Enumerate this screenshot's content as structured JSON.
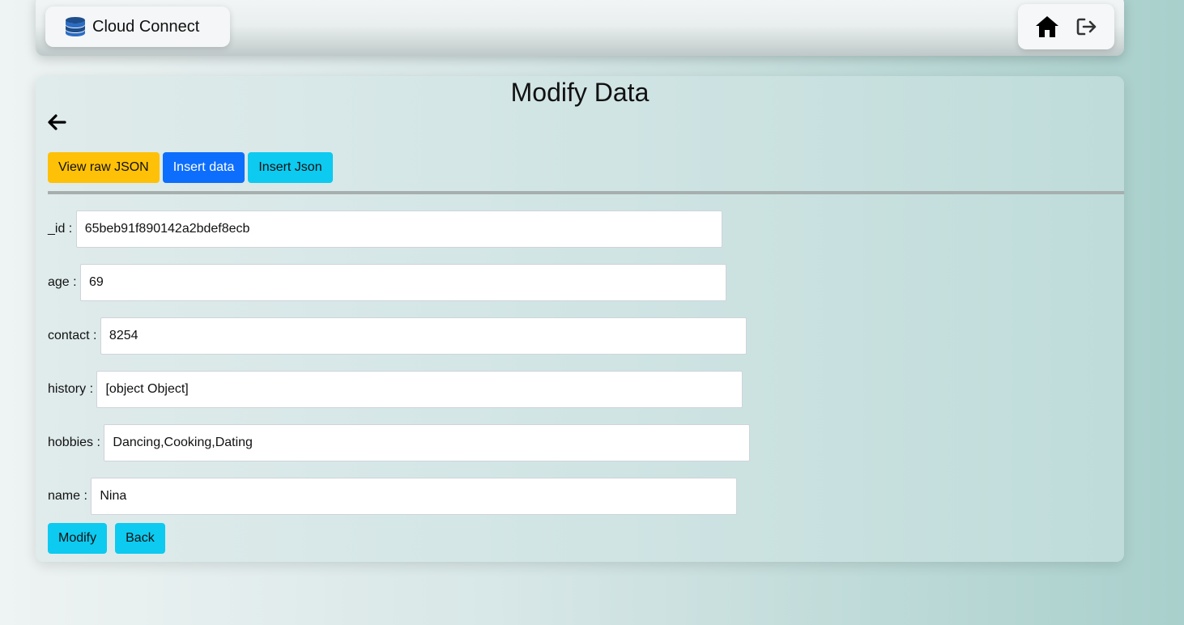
{
  "navbar": {
    "brand_name": "Cloud Connect",
    "brand_icon": "database-icon",
    "home_icon": "home-icon",
    "logout_icon": "logout-icon"
  },
  "page": {
    "title": "Modify Data",
    "back_icon": "arrow-left-icon"
  },
  "toolbar": {
    "view_raw_json": "View raw JSON",
    "insert_data": "Insert data",
    "insert_json": "Insert Json"
  },
  "fields": [
    {
      "label": "_id : ",
      "value": "65beb91f890142a2bdef8ecb"
    },
    {
      "label": "age : ",
      "value": "69"
    },
    {
      "label": "contact : ",
      "value": "8254"
    },
    {
      "label": "history : ",
      "value": "[object Object]"
    },
    {
      "label": "hobbies : ",
      "value": "Dancing,Cooking,Dating"
    },
    {
      "label": "name : ",
      "value": "Nina"
    }
  ],
  "actions": {
    "modify": "Modify",
    "back": "Back"
  },
  "colors": {
    "warning": "#ffc107",
    "primary": "#0d6efd",
    "info": "#0dcaf0"
  }
}
